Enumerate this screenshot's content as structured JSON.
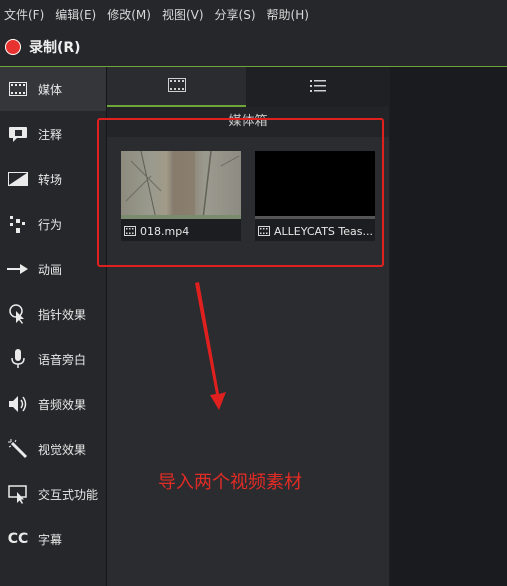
{
  "menu": [
    "文件(F)",
    "编辑(E)",
    "修改(M)",
    "视图(V)",
    "分享(S)",
    "帮助(H)"
  ],
  "record": {
    "label": "录制(R)",
    "color": "#e8322f"
  },
  "sidebar": {
    "items": [
      {
        "label": "媒体",
        "icon": "film-strip-icon",
        "active": true
      },
      {
        "label": "注释",
        "icon": "annotation-callout-icon"
      },
      {
        "label": "转场",
        "icon": "transition-icon"
      },
      {
        "label": "行为",
        "icon": "behaviors-icon"
      },
      {
        "label": "动画",
        "icon": "animation-arrow-icon"
      },
      {
        "label": "指针效果",
        "icon": "cursor-effects-icon"
      },
      {
        "label": "语音旁白",
        "icon": "microphone-icon"
      },
      {
        "label": "音频效果",
        "icon": "speaker-icon"
      },
      {
        "label": "视觉效果",
        "icon": "magic-wand-icon"
      },
      {
        "label": "交互式功能",
        "icon": "interactive-cursor-icon"
      },
      {
        "label": "字幕",
        "icon": "captions-cc-icon"
      }
    ]
  },
  "media_bin": {
    "tabs": [
      {
        "icon": "film-strip-icon"
      },
      {
        "icon": "list-view-icon"
      }
    ],
    "title": "媒体箱",
    "clips": [
      {
        "name": "018.mp4",
        "thumbnail": "forest-frame"
      },
      {
        "name": "ALLEYCATS Teas...",
        "thumbnail": "black-frame"
      }
    ]
  },
  "annotation": {
    "text": "导入两个视频素材",
    "color": "#e22b25"
  },
  "colors": {
    "accent": "#6ea63a",
    "highlight": "#e0201e"
  }
}
